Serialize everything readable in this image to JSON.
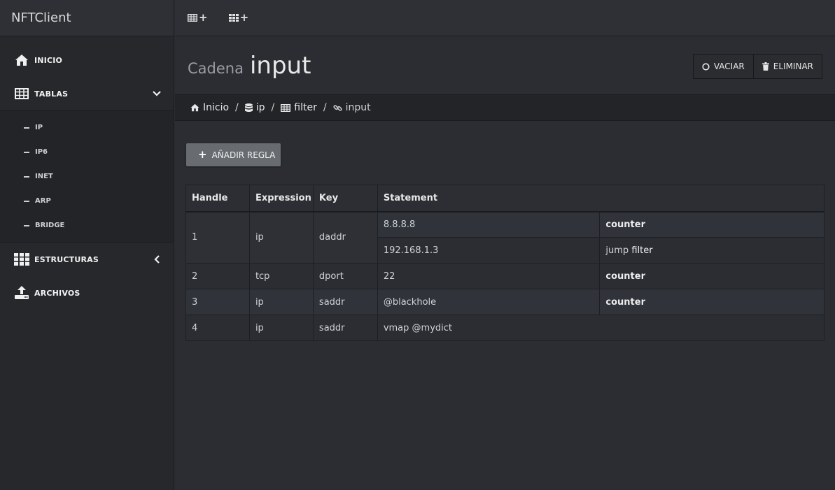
{
  "sidebar": {
    "brand": "NFTClient",
    "items": [
      {
        "label": "INICIO",
        "icon": "home-icon"
      },
      {
        "label": "TABLAS",
        "icon": "table-icon",
        "chevron": "chevron-down-icon"
      },
      {
        "label": "ESTRUCTURAS",
        "icon": "grid-icon",
        "chevron": "chevron-left-icon"
      },
      {
        "label": "ARCHIVOS",
        "icon": "upload-icon"
      }
    ],
    "tablas_sub": [
      "IP",
      "IP6",
      "INET",
      "ARP",
      "BRIDGE"
    ]
  },
  "topbar": {
    "buttons": [
      {
        "icon": "add-table-icon"
      },
      {
        "icon": "add-set-icon"
      }
    ]
  },
  "header": {
    "title_label": "Cadena",
    "title_name": "input",
    "vaciar_label": "VACIAR",
    "eliminar_label": "ELIMINAR"
  },
  "breadcrumb": {
    "items": [
      {
        "label": "Inicio",
        "icon": "home-icon"
      },
      {
        "label": "ip",
        "icon": "database-icon"
      },
      {
        "label": "filter",
        "icon": "table-icon"
      },
      {
        "label": "input",
        "icon": "link-icon"
      }
    ],
    "separator": "/"
  },
  "add_rule_label": "AÑADIR REGLA",
  "table": {
    "headers": [
      "Handle",
      "Expression",
      "Key",
      "Statement"
    ],
    "rows": [
      {
        "handle": "1",
        "expression": "ip",
        "key": "daddr",
        "values": [
          "8.8.8.8",
          "192.168.1.3"
        ],
        "actions": [
          "counter",
          ""
        ],
        "jump": {
          "keyword": "jump",
          "target": "filter"
        }
      },
      {
        "handle": "2",
        "expression": "tcp",
        "key": "dport",
        "value": "22",
        "action": "counter"
      },
      {
        "handle": "3",
        "expression": "ip",
        "key": "saddr",
        "value": "@blackhole",
        "action": "counter"
      },
      {
        "handle": "4",
        "expression": "ip",
        "key": "saddr",
        "value": "vmap @mydict"
      }
    ]
  },
  "colors": {
    "background": "#2b2d32",
    "sidebar": "#26282c",
    "add_button": "#686c71"
  }
}
